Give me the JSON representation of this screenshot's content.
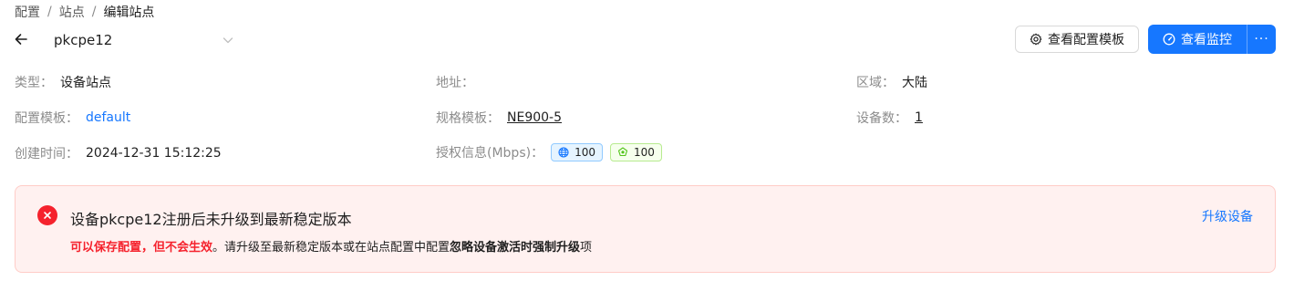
{
  "breadcrumb": {
    "items": [
      "配置",
      "站点",
      "编辑站点"
    ],
    "separator": "/"
  },
  "header": {
    "site_name": "pkcpe12",
    "view_template_button": "查看配置模板",
    "view_monitor_button": "查看监控",
    "more_button": "···"
  },
  "details": {
    "type": {
      "label": "类型",
      "value": "设备站点"
    },
    "address": {
      "label": "地址",
      "value": ""
    },
    "region": {
      "label": "区域",
      "value": "大陆"
    },
    "config_template": {
      "label": "配置模板",
      "value": "default"
    },
    "spec_template": {
      "label": "规格模板",
      "value": "NE900-5"
    },
    "device_count": {
      "label": "设备数",
      "value": "1"
    },
    "created_time": {
      "label": "创建时间",
      "value": "2024-12-31 15:12:25"
    },
    "license": {
      "label": "授权信息(Mbps)",
      "tags": [
        "100",
        "100"
      ]
    }
  },
  "alert": {
    "title": "设备pkcpe12注册后未升级到最新稳定版本",
    "desc_red": "可以保存配置，但不会生效",
    "desc_part1": "。请升级至最新稳定版本或在站点配置中配置",
    "desc_bold": "忽略设备激活时强制升级",
    "desc_part2": "项",
    "action": "升级设备"
  },
  "colors": {
    "primary": "#1677ff",
    "error": "#f5222d",
    "alert_bg": "#fff1f0",
    "alert_border": "#ffccc7"
  },
  "icons": [
    "arrow-left-icon",
    "chevron-down-icon",
    "gear-icon",
    "dashboard-icon",
    "globe-icon",
    "shield-icon",
    "close-circle-icon"
  ]
}
